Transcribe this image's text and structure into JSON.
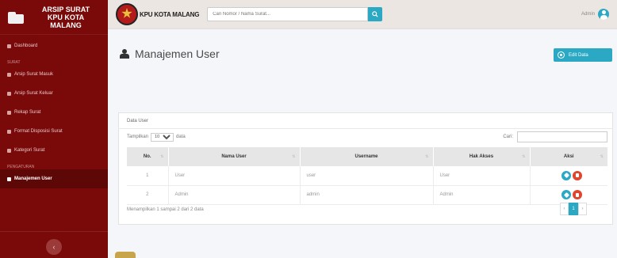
{
  "sidebar": {
    "brand": [
      "ARSIP SURAT",
      "KPU KOTA",
      "MALANG"
    ],
    "items": [
      {
        "label": "Dashboard"
      },
      {
        "label": "Arsip Surat Masuk"
      },
      {
        "label": "Arsip Surat Keluar"
      },
      {
        "label": "Rekap Surat"
      },
      {
        "label": "Format Disposisi Surat"
      },
      {
        "label": "Kategori Surat"
      },
      {
        "label": "Manajemen User"
      }
    ],
    "headings": [
      "SURAT",
      "PENGATURAN"
    ],
    "toggle_icon": "chevron-left-icon"
  },
  "topbar": {
    "org_name": "KPU KOTA MALANG",
    "search_placeholder": "Cari Nomor / Nama Surat...",
    "user_name": "Admin"
  },
  "page": {
    "title": "Manajemen User",
    "edit_button": "Edit Data"
  },
  "panel": {
    "title": "Data User",
    "show_label": "Tampilkan",
    "show_value": "10",
    "show_suffix": "data",
    "search_label": "Cari:"
  },
  "table": {
    "headers": [
      "No.",
      "Nama User",
      "Username",
      "Hak Akses",
      "Aksi"
    ],
    "rows": [
      {
        "no": "1",
        "nama": "User",
        "username": "user",
        "hak": "User"
      },
      {
        "no": "2",
        "nama": "Admin",
        "username": "admin",
        "hak": "Admin"
      }
    ]
  },
  "footer": {
    "info": "Menampilkan 1 sampai 2 dari 2 data",
    "pages": [
      "‹",
      "1",
      "›"
    ]
  },
  "colors": {
    "sidebar": "#7a0a0a",
    "accent": "#2aa8c4",
    "danger": "#e0452e"
  }
}
